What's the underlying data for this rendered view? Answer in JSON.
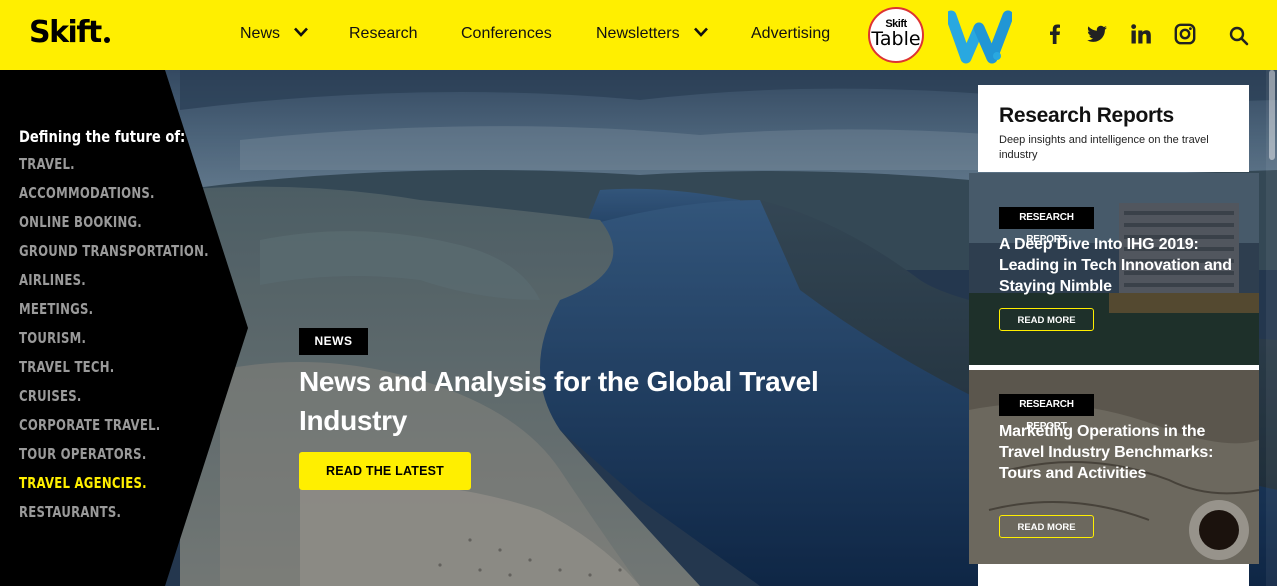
{
  "brand": {
    "logo": "Skift"
  },
  "nav": {
    "items": [
      {
        "label": "News",
        "has_dropdown": true
      },
      {
        "label": "Research",
        "has_dropdown": false
      },
      {
        "label": "Conferences",
        "has_dropdown": false
      },
      {
        "label": "Newsletters",
        "has_dropdown": true
      },
      {
        "label": "Advertising",
        "has_dropdown": false
      }
    ],
    "badge_table": {
      "line1": "Skift",
      "line2": "Table"
    },
    "social_icons": [
      "facebook-icon",
      "twitter-icon",
      "linkedin-icon",
      "instagram-icon"
    ],
    "search_icon": "search-icon"
  },
  "sidebar": {
    "title": "Defining the future of:",
    "items": [
      {
        "label": "TRAVEL."
      },
      {
        "label": "ACCOMMODATIONS."
      },
      {
        "label": "ONLINE BOOKING."
      },
      {
        "label": "GROUND TRANSPORTATION."
      },
      {
        "label": "AIRLINES."
      },
      {
        "label": "MEETINGS."
      },
      {
        "label": "TOURISM."
      },
      {
        "label": "TRAVEL TECH."
      },
      {
        "label": "CRUISES."
      },
      {
        "label": "CORPORATE TRAVEL."
      },
      {
        "label": "TOUR OPERATORS."
      },
      {
        "label": "TRAVEL AGENCIES.",
        "active": true
      },
      {
        "label": "RESTAURANTS."
      }
    ]
  },
  "hero": {
    "tag": "NEWS",
    "headline": "News and Analysis for the Global Travel Industry",
    "cta": "READ THE LATEST"
  },
  "research": {
    "title": "Research Reports",
    "description": "Deep insights and intelligence on the travel industry",
    "cards": [
      {
        "tag": "RESEARCH REPORT",
        "title": "A Deep Dive Into IHG 2019: Leading in Tech Innovation and Staying Nimble",
        "button": "READ MORE"
      },
      {
        "tag": "RESEARCH REPORT",
        "title": "Marketing Operations in the Travel Industry Benchmarks: Tours and Activities",
        "button": "READ MORE"
      }
    ]
  },
  "colors": {
    "brand_yellow": "#FFEF00",
    "panel_black": "#000000",
    "inactive_gray": "#9a9a9a"
  }
}
